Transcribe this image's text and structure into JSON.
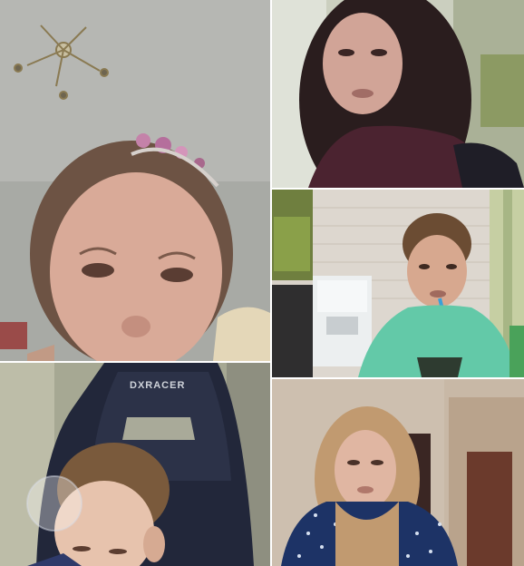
{
  "participants": [
    {
      "id": "tile-1",
      "description_color": "#b9b9b3"
    },
    {
      "id": "tile-2",
      "description_color": "#b9c0a8"
    },
    {
      "id": "tile-3",
      "description_color": "#d9d4cc"
    },
    {
      "id": "tile-4",
      "description_color": "#9a9b8e"
    },
    {
      "id": "tile-5",
      "description_color": "#c8b7a4"
    }
  ],
  "chair_brand": "DXRACER"
}
